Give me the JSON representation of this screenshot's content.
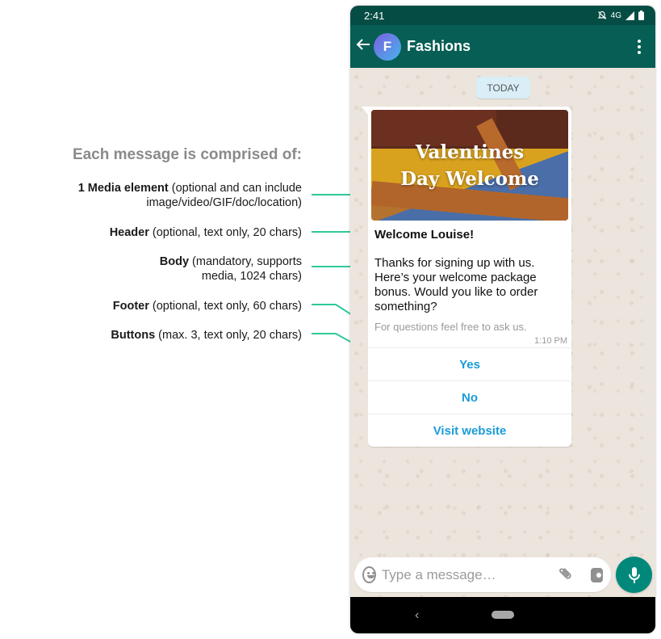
{
  "annotations": {
    "title": "Each message is comprised of:",
    "items": [
      {
        "bold": "1 Media element",
        "line1": " (optional and can include",
        "line2": "image/video/GIF/doc/location)"
      },
      {
        "bold": "Header",
        "line1": " (optional, text only, 20 chars)"
      },
      {
        "bold": "Body",
        "line1": " (mandatory, supports",
        "line2": "media, 1024 chars)"
      },
      {
        "bold": "Footer",
        "line1": " (optional, text only, 60 chars)"
      },
      {
        "bold": "Buttons",
        "line1": " (max. 3, text only, 20 chars)"
      }
    ],
    "arrow_color": "#2ec99a"
  },
  "statusbar": {
    "time": "2:41",
    "network": "4G",
    "icons": [
      "notifications-off-icon",
      "signal-icon",
      "battery-icon"
    ]
  },
  "appbar": {
    "back_icon": "arrow-left-icon",
    "avatar_letter": "F",
    "title": "Fashions",
    "menu_icon": "more-vertical-icon"
  },
  "chat": {
    "date_chip": "TODAY",
    "message": {
      "media_title_line1": "Valentines",
      "media_title_line2": "Day Welcome",
      "header": "Welcome Louise!",
      "body": "Thanks for signing up with us. Here’s your welcome package bonus. Would you like to order something?",
      "footer": "For questions feel free to ask us.",
      "time": "1:10 PM",
      "buttons": [
        "Yes",
        "No",
        "Visit website"
      ]
    }
  },
  "composer": {
    "placeholder": "Type a message…",
    "icons": [
      "emoji-icon",
      "paperclip-icon",
      "camera-icon",
      "microphone-icon"
    ]
  },
  "colors": {
    "header_dark": "#054d44",
    "header": "#075e54",
    "accent_green": "#00897b",
    "button_text": "#1b9bd7",
    "chat_bg": "#ece5dd"
  }
}
